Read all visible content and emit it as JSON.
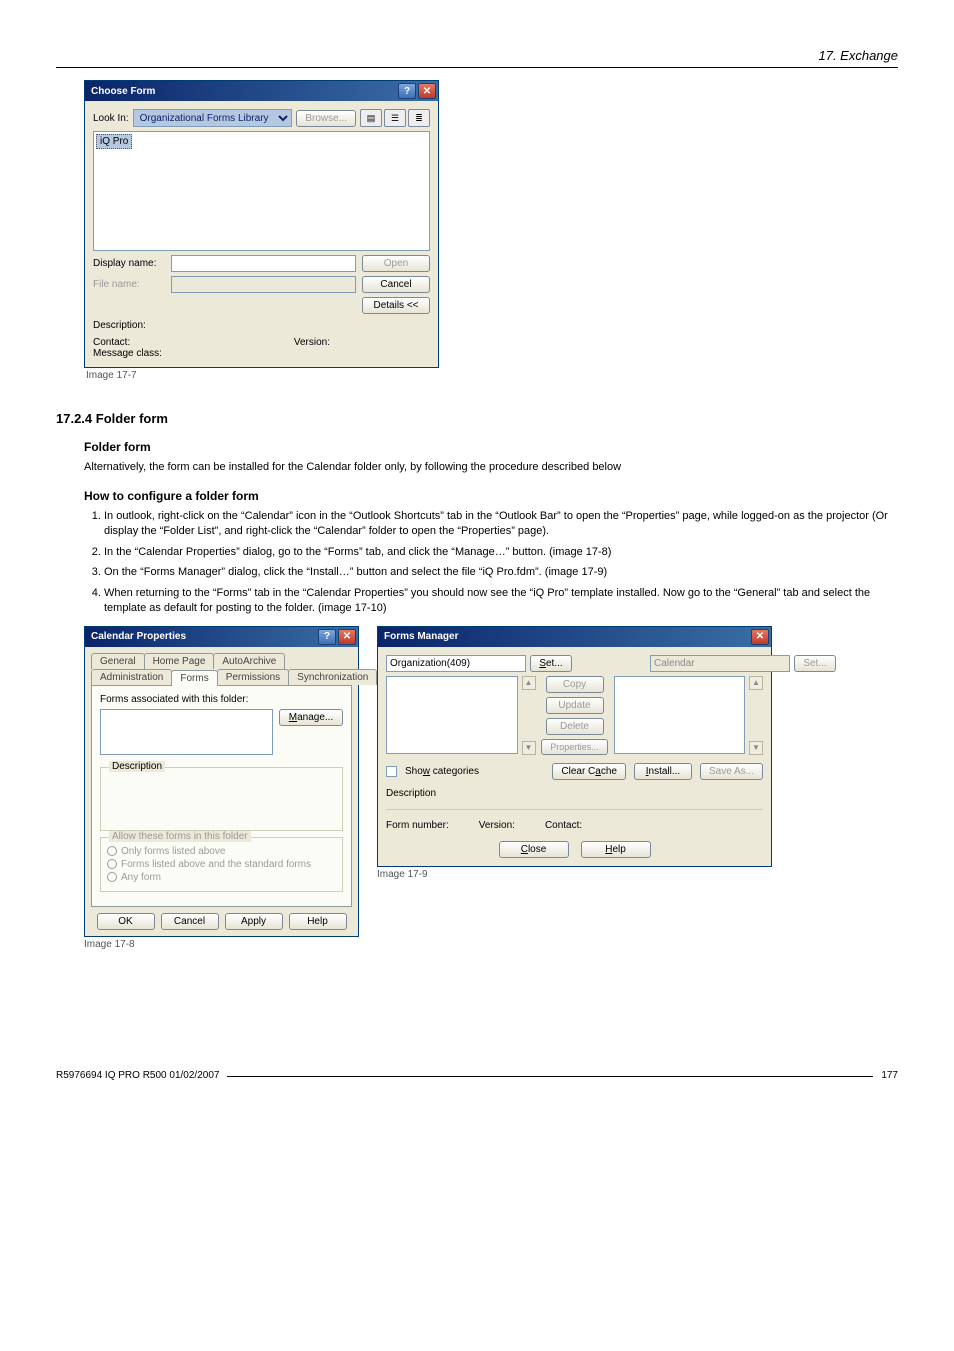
{
  "header": {
    "chapter": "17.  Exchange"
  },
  "choose_form": {
    "title": "Choose Form",
    "look_in_label": "Look In:",
    "look_in_value": "Organizational Forms Library",
    "browse_btn": "Browse...",
    "list_selected": "iQ Pro",
    "display_name_label": "Display name:",
    "display_name_value": "",
    "file_name_label": "File name:",
    "file_name_value": "",
    "open_btn": "Open",
    "cancel_btn": "Cancel",
    "details_btn": "Details <<",
    "description_label": "Description:",
    "contact_label": "Contact:",
    "version_label": "Version:",
    "message_class_label": "Message class:"
  },
  "choose_form_caption": "Image 17-7",
  "section_number": "17.2.4   Folder form",
  "sub1": "Folder form",
  "sub1_text": "Alternatively, the form can be installed for the Calendar folder only, by following the procedure described below",
  "sub2": "How to configure a folder form",
  "steps": [
    "In outlook, right-click on the “Calendar” icon in the “Outlook Shortcuts” tab in the “Outlook Bar” to open the “Properties” page, while logged-on as the projector (Or display the “Folder List”, and right-click the “Calendar” folder to open the “Properties” page).",
    "In the “Calendar Properties” dialog, go to the “Forms” tab, and click the “Manage…” button. (image 17-8)",
    "On the “Forms Manager” dialog, click the “Install…” button and select the file “iQ Pro.fdm”. (image 17-9)",
    "When returning to the “Forms” tab in the “Calendar Properties” you should now see the “iQ Pro” template installed. Now go to the “General” tab and select the template as default for posting to the folder. (image 17-10)"
  ],
  "cal_prop": {
    "title": "Calendar Properties",
    "tabs_row1": [
      "General",
      "Home Page",
      "AutoArchive"
    ],
    "tabs_row2": [
      "Administration",
      "Forms",
      "Permissions",
      "Synchronization"
    ],
    "active_tab": "Forms",
    "forms_assoc_label": "Forms associated with this folder:",
    "manage_btn": "Manage...",
    "description_legend": "Description",
    "allow_legend": "Allow these forms in this folder",
    "radio1": "Only forms listed above",
    "radio2": "Forms listed above and the standard forms",
    "radio3": "Any form",
    "ok_btn": "OK",
    "cancel_btn": "Cancel",
    "apply_btn": "Apply",
    "help_btn": "Help"
  },
  "cal_prop_caption": "Image 17-8",
  "forms_mgr": {
    "title": "Forms Manager",
    "left_header": "Organization(409)",
    "left_set_btn": "Set...",
    "right_header": "Calendar",
    "right_set_btn": "Set...",
    "copy_btn": "Copy",
    "update_btn": "Update",
    "delete_btn": "Delete",
    "properties_btn": "Properties...",
    "show_categories_label": "Show categories",
    "clear_cache_btn": "Clear Cache",
    "install_btn": "Install...",
    "save_as_btn": "Save As...",
    "description_label": "Description",
    "form_number_label": "Form number:",
    "version_label": "Version:",
    "contact_label": "Contact:",
    "close_btn": "Close",
    "help_btn": "Help"
  },
  "forms_mgr_caption": "Image 17-9",
  "footer": {
    "doc_id": "R5976694  IQ PRO R500  01/02/2007",
    "page_no": "177"
  }
}
